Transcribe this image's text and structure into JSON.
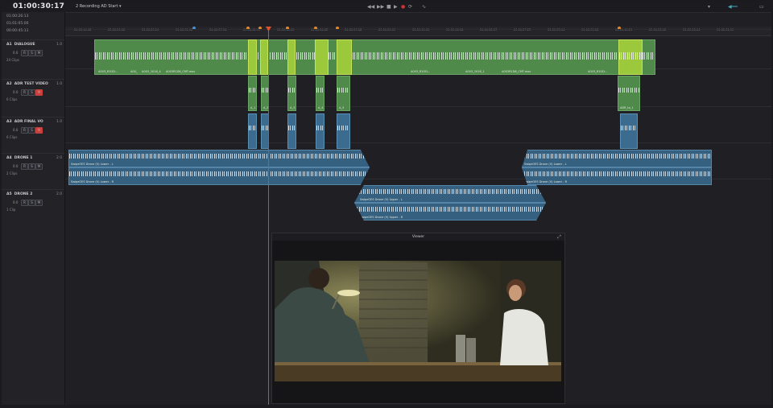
{
  "header": {
    "timecode": "01:00:30:17",
    "timeline_name": "2 Recording AD Start ▾",
    "timecodes": [
      "01:00:26:13",
      "01:01:05:00",
      "00:00:45:11"
    ]
  },
  "tracks": [
    {
      "id": "A1",
      "name": "DIALOGUE",
      "format": "1.0",
      "volume": "0.0",
      "clips": "24 Clips"
    },
    {
      "id": "A2",
      "name": "ADR TEST VIDEO",
      "format": "1.0",
      "volume": "0.0",
      "clips": "6 Clips"
    },
    {
      "id": "A3",
      "name": "ADR FINAL VO",
      "format": "1.0",
      "volume": "0.0",
      "clips": "6 Clips"
    },
    {
      "id": "A4",
      "name": "DRONE 1",
      "format": "2.0",
      "volume": "0.0",
      "clips": "2 Clips"
    },
    {
      "id": "A5",
      "name": "DRONE 2",
      "format": "2.0",
      "volume": "0.0",
      "clips": "1 Clip"
    }
  ],
  "ruler_labels": [
    "01:00:14:08",
    "01:00:20:00",
    "01:00:25:21",
    "01:00:31:12",
    "01:00:37:04",
    "01:00:42:19",
    "01:00:48:10",
    "01:00:54:02",
    "01:00:59:18",
    "01:01:05:09",
    "01:01:11:00",
    "01:01:16:16",
    "01:01:22:07",
    "01:01:27:23",
    "01:01:33:14",
    "01:01:39:06",
    "01:01:44:21",
    "01:01:50:12",
    "01:01:56:04",
    "01:02:01:19"
  ],
  "clip_labels": {
    "dialogue": [
      "A003_R1OD...",
      "A00_",
      "A003_1016_4",
      "A003R1D6_CMT.mov",
      "A003_",
      "A00..",
      "A003_",
      "A00_",
      "A00_",
      "A003_R1OD...",
      "A003_R1OD...",
      "A003_1016_1",
      "A003R1D6_CMT.mov",
      "A003_R1OD...",
      "A003_"
    ],
    "adr": [
      "A_1",
      "A_2",
      "A_3",
      "A_4",
      "A_5",
      "ADR_to_1"
    ],
    "drone1_a": "SwipeOES Drone (V) Lower - L",
    "drone1_b": "SwipeOES Drone (V) Lower - R",
    "drone1_c": "SwipeOES Drone (V) Lower - L",
    "drone1_d": "SwipeOES Drone (V) Lower - R",
    "drone2_a": "SwipeOES Drone (V) Upper - L",
    "drone2_b": "SwipeOES Drone (V) Upper - R"
  },
  "viewer": {
    "title": "Viewer"
  },
  "colors": {
    "dialogue": "#4f8a4b",
    "adr": "#9cc93c",
    "drone": "#3b6b8e",
    "playhead": "#d14a2e"
  }
}
